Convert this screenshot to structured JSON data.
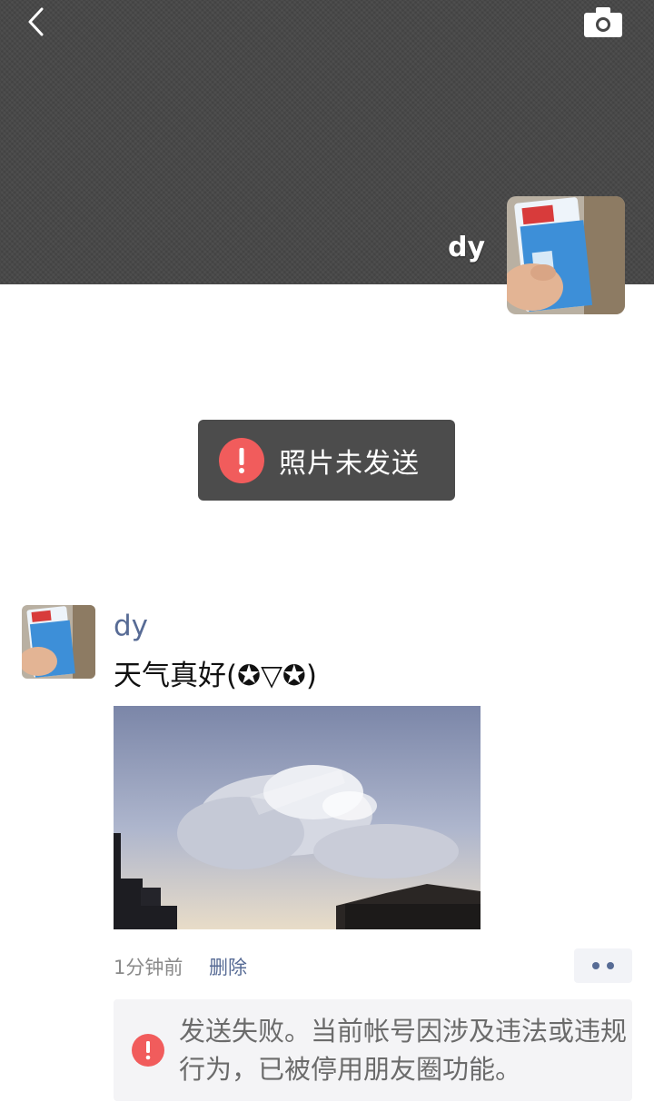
{
  "header": {
    "user_name": "dy"
  },
  "toast": {
    "message": "照片未发送"
  },
  "post": {
    "author": "dy",
    "text": "天气真好(✪▽✪)",
    "time": "1分钟前",
    "delete_label": "删除",
    "failure_message": "发送失败。当前帐号因涉及违法或违规行为，已被停用朋友圈功能。"
  },
  "icons": {
    "back": "chevron-left-icon",
    "camera": "camera-icon",
    "error": "exclamation-circle-icon",
    "more": "more-dots-icon"
  },
  "colors": {
    "cover_bg": "#474747",
    "link_blue": "#576b95",
    "error_red": "#f15c5c",
    "toast_bg": "#4c4c4c"
  }
}
